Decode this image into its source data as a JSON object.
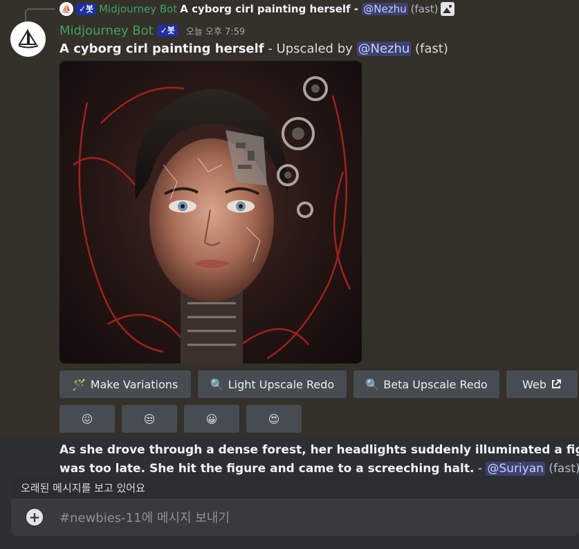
{
  "reply": {
    "bot_badge": "✓봇",
    "author": "Midjourney Bot",
    "prompt": "A cyborg cirl painting herself",
    "separator": " - ",
    "mention": "@Nezhu",
    "speed": "(fast)",
    "image_icon": "image-icon"
  },
  "message": {
    "author": "Midjourney Bot",
    "bot_badge": "✓봇",
    "timestamp": "오늘 오후 7:59",
    "prompt": "A cyborg cirl painting herself",
    "suffix": " - Upscaled by ",
    "mention": "@Nezhu",
    "speed": " (fast)"
  },
  "buttons": [
    {
      "label": "Make Variations",
      "icon": "magic-wand-icon"
    },
    {
      "label": "Light Upscale Redo",
      "icon": "magnifier-icon"
    },
    {
      "label": "Beta Upscale Redo",
      "icon": "magnifier-icon"
    },
    {
      "label": "Web",
      "icon": "external-link-icon"
    }
  ],
  "reactions": [
    {
      "emoji": "😖",
      "icon": "confounded-face-icon"
    },
    {
      "emoji": "😒",
      "icon": "unamused-face-icon"
    },
    {
      "emoji": "😀",
      "icon": "grinning-face-icon"
    },
    {
      "emoji": "😍",
      "icon": "heart-eyes-face-icon"
    }
  ],
  "next_message": {
    "line1": "As she drove through a dense forest, her headlights suddenly illuminated a figure standing",
    "line2": "was too late. She hit the figure and came to a screeching halt.",
    "dash": " - ",
    "mention": "@Suriyan",
    "speed": " (fast)"
  },
  "old_messages_banner": "오래된 메시지를 보고 있어요",
  "input": {
    "placeholder": "#newbies-11에 메시지 보내기"
  },
  "colors": {
    "author_green": "#3ba55d",
    "mention_bg": "#3c4270",
    "button_bg": "#474c52",
    "bot_badge": "#1f2fa6"
  }
}
